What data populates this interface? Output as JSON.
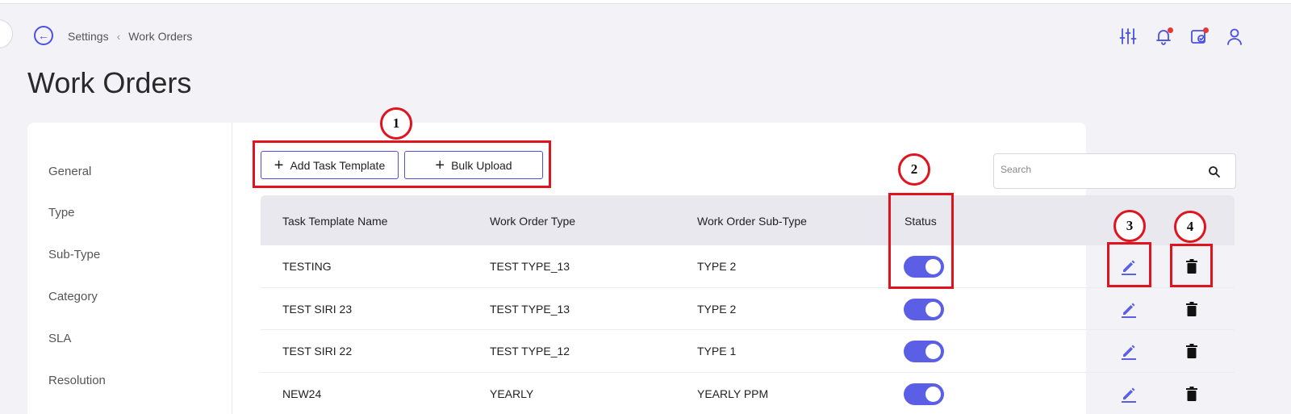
{
  "breadcrumb": {
    "parent": "Settings",
    "current": "Work Orders"
  },
  "page_title": "Work Orders",
  "top_icons": [
    "sliders-icon",
    "bell-icon",
    "calendar-check-icon",
    "user-icon"
  ],
  "sidebar": {
    "items": [
      "General",
      "Type",
      "Sub-Type",
      "Category",
      "SLA",
      "Resolution"
    ]
  },
  "actions": {
    "add_task_template": "Add Task Template",
    "bulk_upload": "Bulk Upload"
  },
  "search": {
    "placeholder": "Search"
  },
  "table": {
    "headers": [
      "Task Template Name",
      "Work Order Type",
      "Work Order Sub-Type",
      "Status"
    ],
    "rows": [
      {
        "name": "TESTING",
        "type": "TEST TYPE_13",
        "subtype": "TYPE 2",
        "status": true
      },
      {
        "name": "TEST SIRI 23",
        "type": "TEST TYPE_13",
        "subtype": "TYPE 2",
        "status": true
      },
      {
        "name": "TEST SIRI 22",
        "type": "TEST TYPE_12",
        "subtype": "TYPE 1",
        "status": true
      },
      {
        "name": "NEW24",
        "type": "YEARLY",
        "subtype": "YEARLY PPM",
        "status": true
      }
    ]
  },
  "annotations": [
    "1",
    "2",
    "3",
    "4"
  ],
  "colors": {
    "accent": "#4b50e0",
    "toggle": "#5b5fe6",
    "annotation": "#e0141e",
    "badge": "#e53935"
  }
}
